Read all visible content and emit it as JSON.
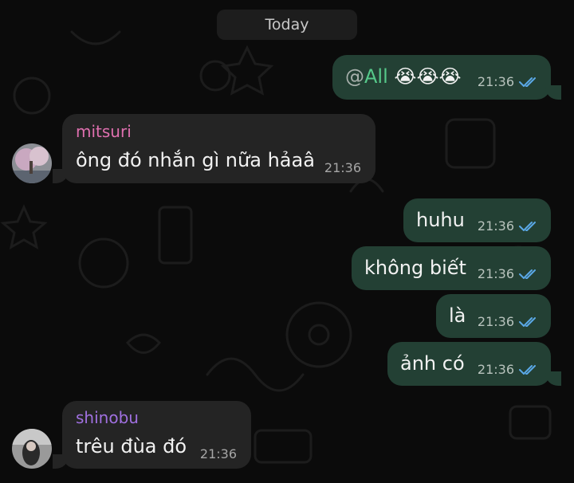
{
  "date_separator": "Today",
  "colors": {
    "outgoing_bubble": "#234034",
    "incoming_bubble": "#242424",
    "read_checks": "#5aa8e6",
    "mention": "#56c98a",
    "sender_mitsuri": "#e070b0",
    "sender_shinobu": "#a070e0"
  },
  "messages": [
    {
      "direction": "out",
      "mention_at": "@",
      "mention_name": "All",
      "emoji": "😭😭😭",
      "time": "21:36",
      "status_icon": "double-check-icon"
    },
    {
      "direction": "in",
      "sender": "mitsuri",
      "text": "ông đó nhắn gì nữa hảaâ",
      "time": "21:36",
      "avatar_icon": "mitsuri-avatar"
    },
    {
      "direction": "out",
      "text": "huhu",
      "time": "21:36",
      "status_icon": "double-check-icon"
    },
    {
      "direction": "out",
      "text": "không biết",
      "time": "21:36",
      "status_icon": "double-check-icon"
    },
    {
      "direction": "out",
      "text": "là",
      "time": "21:36",
      "status_icon": "double-check-icon"
    },
    {
      "direction": "out",
      "text": "ảnh có",
      "time": "21:36",
      "status_icon": "double-check-icon"
    },
    {
      "direction": "in",
      "sender": "shinobu",
      "text": "trêu đùa đó",
      "time": "21:36",
      "avatar_icon": "shinobu-avatar"
    }
  ]
}
